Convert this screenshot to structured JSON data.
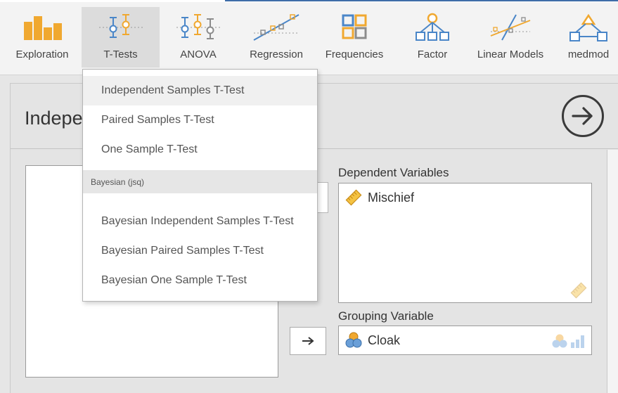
{
  "ribbon": {
    "items": [
      {
        "label": "Exploration",
        "icon": "bar-chart-icon"
      },
      {
        "label": "T-Tests",
        "icon": "ttest-icon"
      },
      {
        "label": "ANOVA",
        "icon": "anova-icon"
      },
      {
        "label": "Regression",
        "icon": "regression-icon"
      },
      {
        "label": "Frequencies",
        "icon": "frequencies-icon"
      },
      {
        "label": "Factor",
        "icon": "factor-icon"
      },
      {
        "label": "Linear Models",
        "icon": "linear-models-icon"
      },
      {
        "label": "medmod",
        "icon": "medmod-icon"
      }
    ],
    "active": "T-Tests"
  },
  "menu": {
    "items": [
      "Independent Samples T-Test",
      "Paired Samples T-Test",
      "One Sample T-Test"
    ],
    "group_header": "Bayesian (jsq)",
    "bayes_items": [
      "Bayesian Independent Samples T-Test",
      "Bayesian Paired Samples T-Test",
      "Bayesian One Sample T-Test"
    ]
  },
  "panel": {
    "title": "Indepe",
    "dependent_label": "Dependent Variables",
    "dependent_vars": [
      "Mischief"
    ],
    "grouping_label": "Grouping Variable",
    "grouping_var": "Cloak"
  },
  "colors": {
    "accent_orange": "#f0a830",
    "icon_blue": "#4a86c8",
    "icon_grey": "#8c8c8c",
    "menu_hover": "#f0f0f0",
    "ruler_yellow": "#f5c342"
  }
}
